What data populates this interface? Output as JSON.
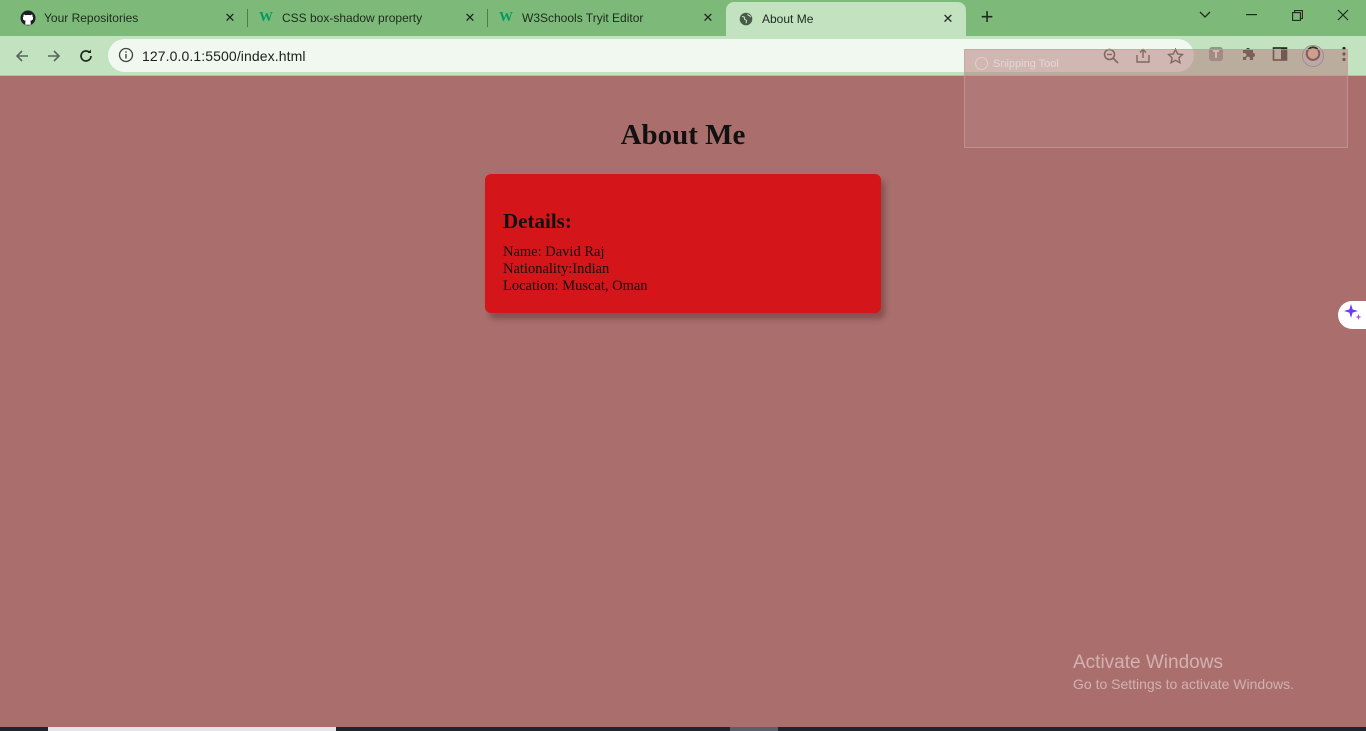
{
  "browser": {
    "tabs": [
      {
        "label": "Your Repositories",
        "icon": "github-icon",
        "active": false
      },
      {
        "label": "CSS box-shadow property",
        "icon": "w3schools-icon",
        "active": false
      },
      {
        "label": "W3Schools Tryit Editor",
        "icon": "w3schools-icon",
        "active": false
      },
      {
        "label": "About Me",
        "icon": "globe-icon",
        "active": true
      }
    ],
    "new_tab_glyph": "+",
    "address": {
      "url": "127.0.0.1:5500/index.html"
    },
    "snipping_tool_label": "Snipping Tool"
  },
  "page": {
    "title": "About Me",
    "card": {
      "heading": "Details:",
      "name_line": "Name: David Raj",
      "nationality_line": "Nationality:Indian",
      "location_line": "Location: Muscat, Oman"
    }
  },
  "watermark": {
    "line1": "Activate Windows",
    "line2": "Go to Settings to activate Windows."
  },
  "colors": {
    "tabstrip": "#7dba7a",
    "toolbar": "#c2e2c0",
    "page_background": "#aa6f6d",
    "card_background": "#d4161a"
  }
}
